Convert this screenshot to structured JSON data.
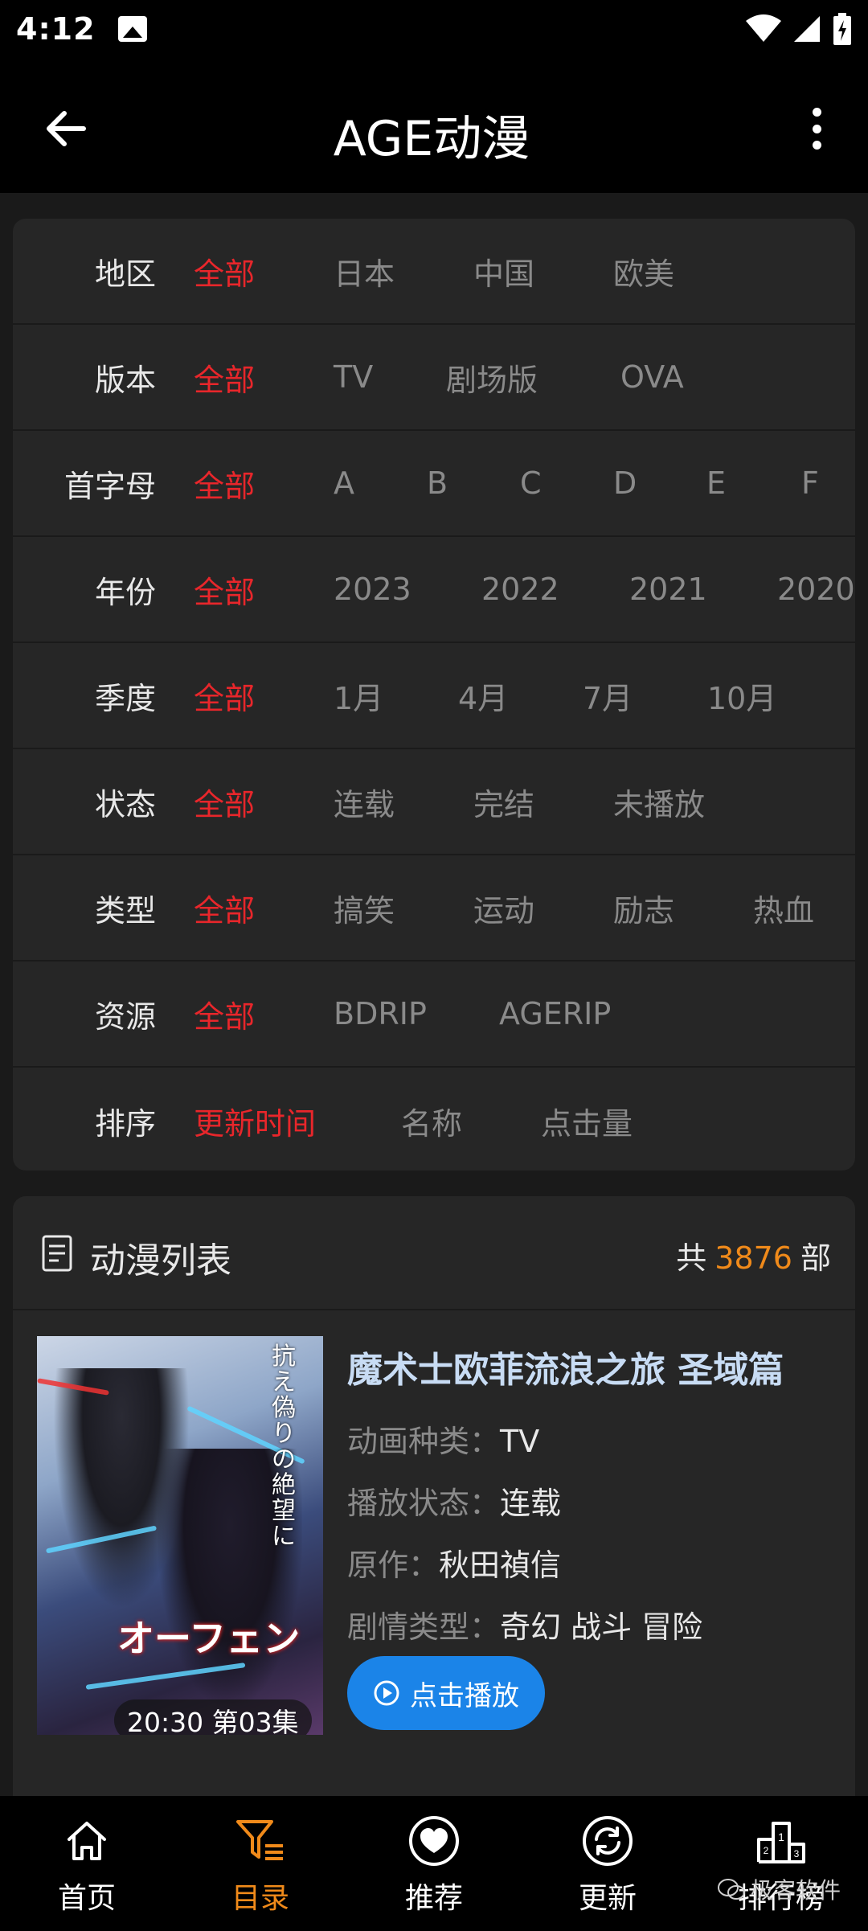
{
  "status_bar": {
    "time": "4:12"
  },
  "app_bar": {
    "title": "AGE动漫"
  },
  "filters": [
    {
      "label": "地区",
      "options": [
        "全部",
        "日本",
        "中国",
        "欧美"
      ]
    },
    {
      "label": "版本",
      "options": [
        "全部",
        "TV",
        "剧场版",
        "OVA"
      ]
    },
    {
      "label": "首字母",
      "options": [
        "全部",
        "A",
        "B",
        "C",
        "D",
        "E",
        "F"
      ]
    },
    {
      "label": "年份",
      "options": [
        "全部",
        "2023",
        "2022",
        "2021",
        "2020"
      ]
    },
    {
      "label": "季度",
      "options": [
        "全部",
        "1月",
        "4月",
        "7月",
        "10月"
      ]
    },
    {
      "label": "状态",
      "options": [
        "全部",
        "连载",
        "完结",
        "未播放"
      ]
    },
    {
      "label": "类型",
      "options": [
        "全部",
        "搞笑",
        "运动",
        "励志",
        "热血"
      ]
    },
    {
      "label": "资源",
      "options": [
        "全部",
        "BDRIP",
        "AGERIP"
      ]
    },
    {
      "label": "排序",
      "options": [
        "更新时间",
        "名称",
        "点击量"
      ]
    }
  ],
  "list": {
    "title": "动漫列表",
    "count_prefix": "共",
    "count": "3876",
    "count_suffix": "部"
  },
  "anime": {
    "title": "魔术士欧菲流浪之旅 圣域篇",
    "episode": "20:30 第03集",
    "poster_logo": "オーフェン",
    "poster_text": "抗え偽りの絶望に",
    "meta": [
      {
        "key": "动画种类：",
        "value": "TV"
      },
      {
        "key": "播放状态：",
        "value": "连载"
      },
      {
        "key": "原作：",
        "value": "秋田禎信"
      },
      {
        "key": "剧情类型：",
        "value": "奇幻 战斗 冒险"
      }
    ],
    "play_label": "点击播放"
  },
  "bottom_nav": [
    {
      "label": "首页",
      "icon": "home-icon"
    },
    {
      "label": "目录",
      "icon": "catalog-filter-icon",
      "active": true
    },
    {
      "label": "推荐",
      "icon": "heart-icon"
    },
    {
      "label": "更新",
      "icon": "refresh-icon"
    },
    {
      "label": "排行榜",
      "icon": "ranking-icon"
    }
  ],
  "watermark": "极客软件",
  "colors": {
    "active_red": "#e8262b",
    "accent_orange": "#f08a1a",
    "play_blue": "#1b84e8"
  }
}
